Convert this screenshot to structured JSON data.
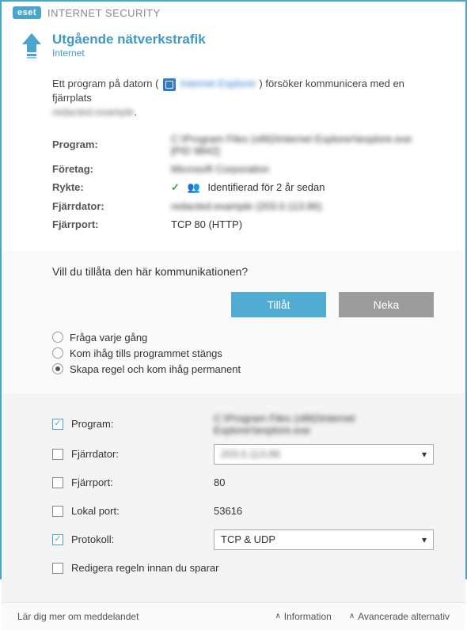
{
  "titlebar": {
    "brand": "eset",
    "product": "INTERNET SECURITY"
  },
  "header": {
    "title": "Utgående nätverkstrafik",
    "subtitle": "Internet"
  },
  "intro": {
    "pre": "Ett program på datorn (",
    "appname": "Internet Explorer",
    "post": ") försöker kommunicera med en fjärrplats",
    "sub": "redacted.example"
  },
  "details": {
    "program_label": "Program:",
    "program_value": "C:\\Program Files (x86)\\Internet Explorer\\iexplore.exe [PID 9842]",
    "company_label": "Företag:",
    "company_value": "Microsoft Corporation",
    "reputation_label": "Rykte:",
    "reputation_text": "Identifierad för 2 år sedan",
    "remotehost_label": "Fjärrdator:",
    "remotehost_value": "redacted.example (203.0.113.86)",
    "remoteport_label": "Fjärrport:",
    "remoteport_value": "TCP 80 (HTTP)"
  },
  "prompt": {
    "question": "Vill du tillåta den här kommunikationen?",
    "allow": "Tillåt",
    "deny": "Neka",
    "opt_ask": "Fråga varje gång",
    "opt_session": "Kom ihåg tills programmet stängs",
    "opt_rule": "Skapa regel och kom ihåg permanent"
  },
  "rules": {
    "program_label": "Program:",
    "program_value": "C:\\Program Files (x86)\\Internet Explorer\\iexplore.exe",
    "remotehost_label": "Fjärrdator:",
    "remotehost_value": "203.0.113.86",
    "remoteport_label": "Fjärrport:",
    "remoteport_value": "80",
    "localport_label": "Lokal port:",
    "localport_value": "53616",
    "protocol_label": "Protokoll:",
    "protocol_value": "TCP & UDP",
    "edit_label": "Redigera regeln innan du sparar"
  },
  "footer": {
    "learn": "Lär dig mer om meddelandet",
    "info": "Information",
    "advanced": "Avancerade alternativ"
  }
}
